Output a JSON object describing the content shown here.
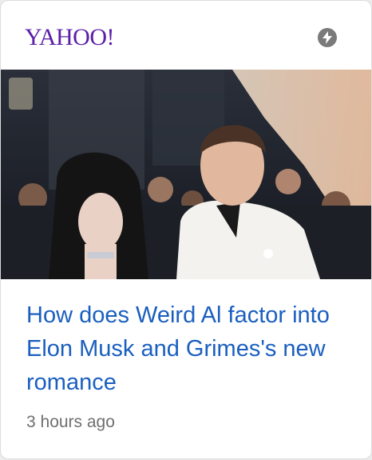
{
  "card": {
    "source": "YAHOO!",
    "source_color": "#5a1fa8",
    "amp_icon": "lightning-bolt-icon",
    "headline": "How does Weird Al factor into Elon Musk and Grimes's new romance",
    "headline_color": "#1a5fbf",
    "timestamp": "3 hours ago"
  }
}
